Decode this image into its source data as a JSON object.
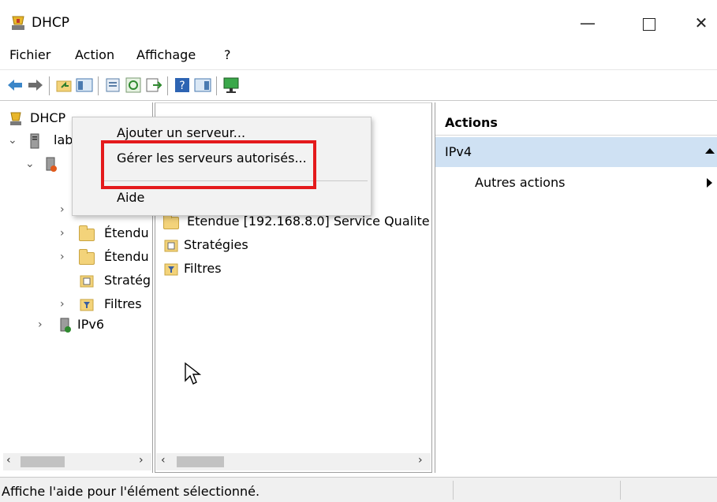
{
  "window": {
    "title": "DHCP",
    "min_label": "—",
    "close_label": "✕"
  },
  "menu": [
    "Fichier",
    "Action",
    "Affichage",
    "?"
  ],
  "tree": {
    "root": "DHCP",
    "server": "lab",
    "items": [
      "Étendu",
      "Étendu",
      "Stratég",
      "Filtres"
    ],
    "ipv6": "IPv6"
  },
  "middle": {
    "items": [
      "Etendue [192.168.8.0] Service Qualite",
      "Stratégies",
      "Filtres"
    ]
  },
  "actions": {
    "header": "Actions",
    "section": "IPv4",
    "other": "Autres actions"
  },
  "context_menu": {
    "add_server": "Ajouter un serveur...",
    "manage_authorized": "Gérer les serveurs autorisés...",
    "help": "Aide"
  },
  "status": {
    "text": "Affiche l'aide pour l'élément sélectionné."
  },
  "colors": {
    "highlight": "#e41a1c",
    "selection": "#cfe1f3"
  }
}
